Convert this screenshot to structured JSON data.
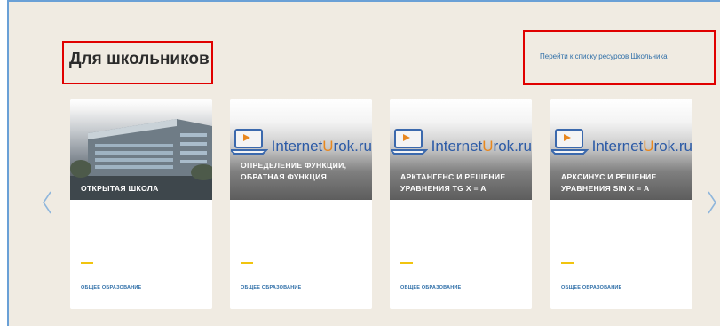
{
  "section": {
    "title": "Для школьников",
    "all_link": "Перейти к списку ресурсов Школьника"
  },
  "carousel": {
    "prev_icon": "chevron-left-icon",
    "next_icon": "chevron-right-icon",
    "cards": [
      {
        "title": "ОТКРЫТАЯ ШКОЛА",
        "category": "ОБЩЕЕ ОБРАЗОВАНИЕ",
        "thumbnail": "building-photo"
      },
      {
        "title": "ОПРЕДЕЛЕНИЕ ФУНКЦИИ, ОБРАТНАЯ ФУНКЦИЯ",
        "category": "ОБЩЕЕ ОБРАЗОВАНИЕ",
        "thumbnail": "internet-urok-logo",
        "brand_main": "Internet",
        "brand_accent": "U",
        "brand_tail": "rok.ru"
      },
      {
        "title": "АРКТАНГЕНС И РЕШЕНИЕ УРАВНЕНИЯ TG X = A",
        "category": "ОБЩЕЕ ОБРАЗОВАНИЕ",
        "thumbnail": "internet-urok-logo",
        "brand_main": "Internet",
        "brand_accent": "U",
        "brand_tail": "rok.ru"
      },
      {
        "title": "АРКСИНУС И РЕШЕНИЕ УРАВНЕНИЯ SIN X = A",
        "category": "ОБЩЕЕ ОБРАЗОВАНИЕ",
        "thumbnail": "internet-urok-logo",
        "brand_main": "Internet",
        "brand_accent": "U",
        "brand_tail": "rok.ru"
      }
    ]
  },
  "colors": {
    "background": "#f0ebe2",
    "link": "#2f6fa8",
    "accent": "#f1c40f",
    "highlight": "#e00000",
    "brand_blue": "#2b5aa6",
    "brand_orange": "#e8871e"
  }
}
